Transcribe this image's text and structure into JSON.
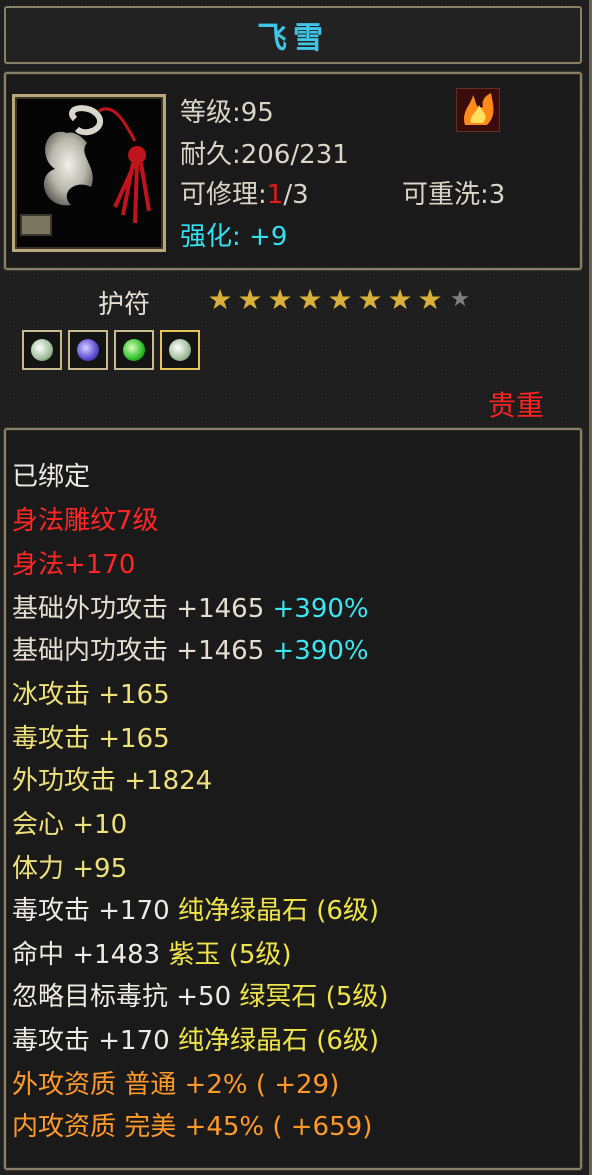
{
  "title": "飞雪",
  "info": {
    "level_label": "等级:",
    "level": "95",
    "durability_label": "耐久:",
    "durability": "206/231",
    "repair_label": "可修理:",
    "repair_current": "1",
    "repair_rest": "/3",
    "rewash_label": "可重洗:",
    "rewash": "3",
    "enhance_label": "强化:",
    "enhance": "+9"
  },
  "type_label": "护符",
  "stars": {
    "filled": 8,
    "total": 9
  },
  "gems": [
    "white-gem-icon",
    "purple-gem-icon",
    "green-gem-icon",
    "white-gem-icon"
  ],
  "precious": "贵重",
  "stats": {
    "bound": "已绑定",
    "engrave": "身法雕纹7级",
    "shenfa": "身法+170",
    "ext_base_label": "基础外功攻击",
    "ext_base_val": "+1465",
    "ext_base_pct": "+390%",
    "int_base_label": "基础内功攻击",
    "int_base_val": "+1465",
    "int_base_pct": "+390%",
    "ice": "冰攻击  +165",
    "poison": "毒攻击  +165",
    "ext_atk": "外功攻击  +1824",
    "crit": "会心  +10",
    "stamina": "体力  +95",
    "gem1_label": "毒攻击  +170",
    "gem1_name": "纯净绿晶石 (6级)",
    "gem2_label": "命中  +1483",
    "gem2_name": "紫玉 (5级)",
    "gem3_label": "忽略目标毒抗  +50",
    "gem3_name": "绿冥石 (5级)",
    "gem4_label": "毒攻击  +170",
    "gem4_name": "纯净绿晶石 (6级)",
    "ext_q": "外攻资质    普通  +2% ( +29)",
    "int_q": "内攻资质    完美  +45% ( +659)"
  }
}
